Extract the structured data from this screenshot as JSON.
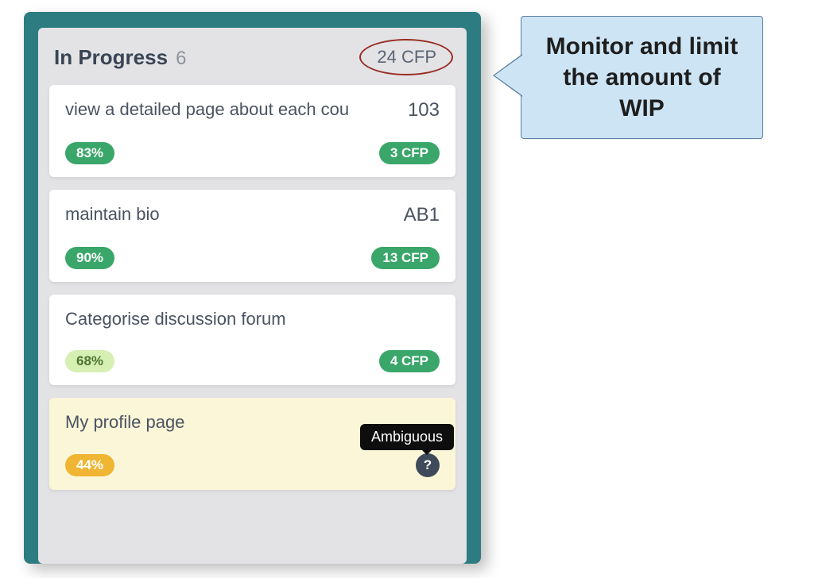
{
  "column": {
    "title": "In Progress",
    "count": "6",
    "cfp": "24 CFP"
  },
  "cards": [
    {
      "title": "view a detailed page about each cou",
      "id": "103",
      "percent": "83%",
      "percent_class": "pct-high",
      "cfp": "3 CFP",
      "highlight": false,
      "show_help": false
    },
    {
      "title": "maintain bio",
      "id": "AB1",
      "percent": "90%",
      "percent_class": "pct-high",
      "cfp": "13 CFP",
      "highlight": false,
      "show_help": false
    },
    {
      "title": "Categorise discussion forum",
      "id": "",
      "percent": "68%",
      "percent_class": "pct-mid",
      "cfp": "4 CFP",
      "highlight": false,
      "show_help": false
    },
    {
      "title": "My profile page",
      "id": "",
      "percent": "44%",
      "percent_class": "pct-low",
      "cfp": "",
      "highlight": true,
      "show_help": true
    }
  ],
  "tooltip": "Ambiguous",
  "help_glyph": "?",
  "callout": "Monitor and limit the amount of WIP"
}
